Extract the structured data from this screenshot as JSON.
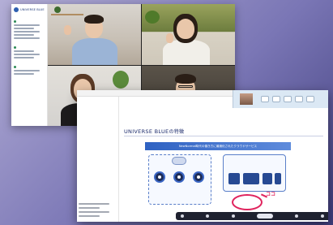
{
  "background": {
    "gradient_from": "#b3aed6",
    "gradient_to": "#3f3d7c"
  },
  "meeting_window": {
    "logo_text": "UNIVERSE BLUE",
    "sidebar_sections": [
      "",
      "",
      ""
    ],
    "participants": [
      {
        "name": "",
        "gesture": "wave"
      },
      {
        "name": "",
        "gesture": "wave"
      },
      {
        "name": "",
        "gesture": ""
      },
      {
        "name": "",
        "gesture": ""
      }
    ]
  },
  "webinar_window": {
    "slide": {
      "title_en": "UNIVERSE BLUE",
      "title_ja": "の特徴",
      "banner_text": "NewNormal時代の働き方に最適化されたクラウドサービス",
      "highlight_text": "",
      "callout_label": "ココ",
      "accent_color": "#e0245e",
      "primary_color": "#2f62c2"
    }
  }
}
